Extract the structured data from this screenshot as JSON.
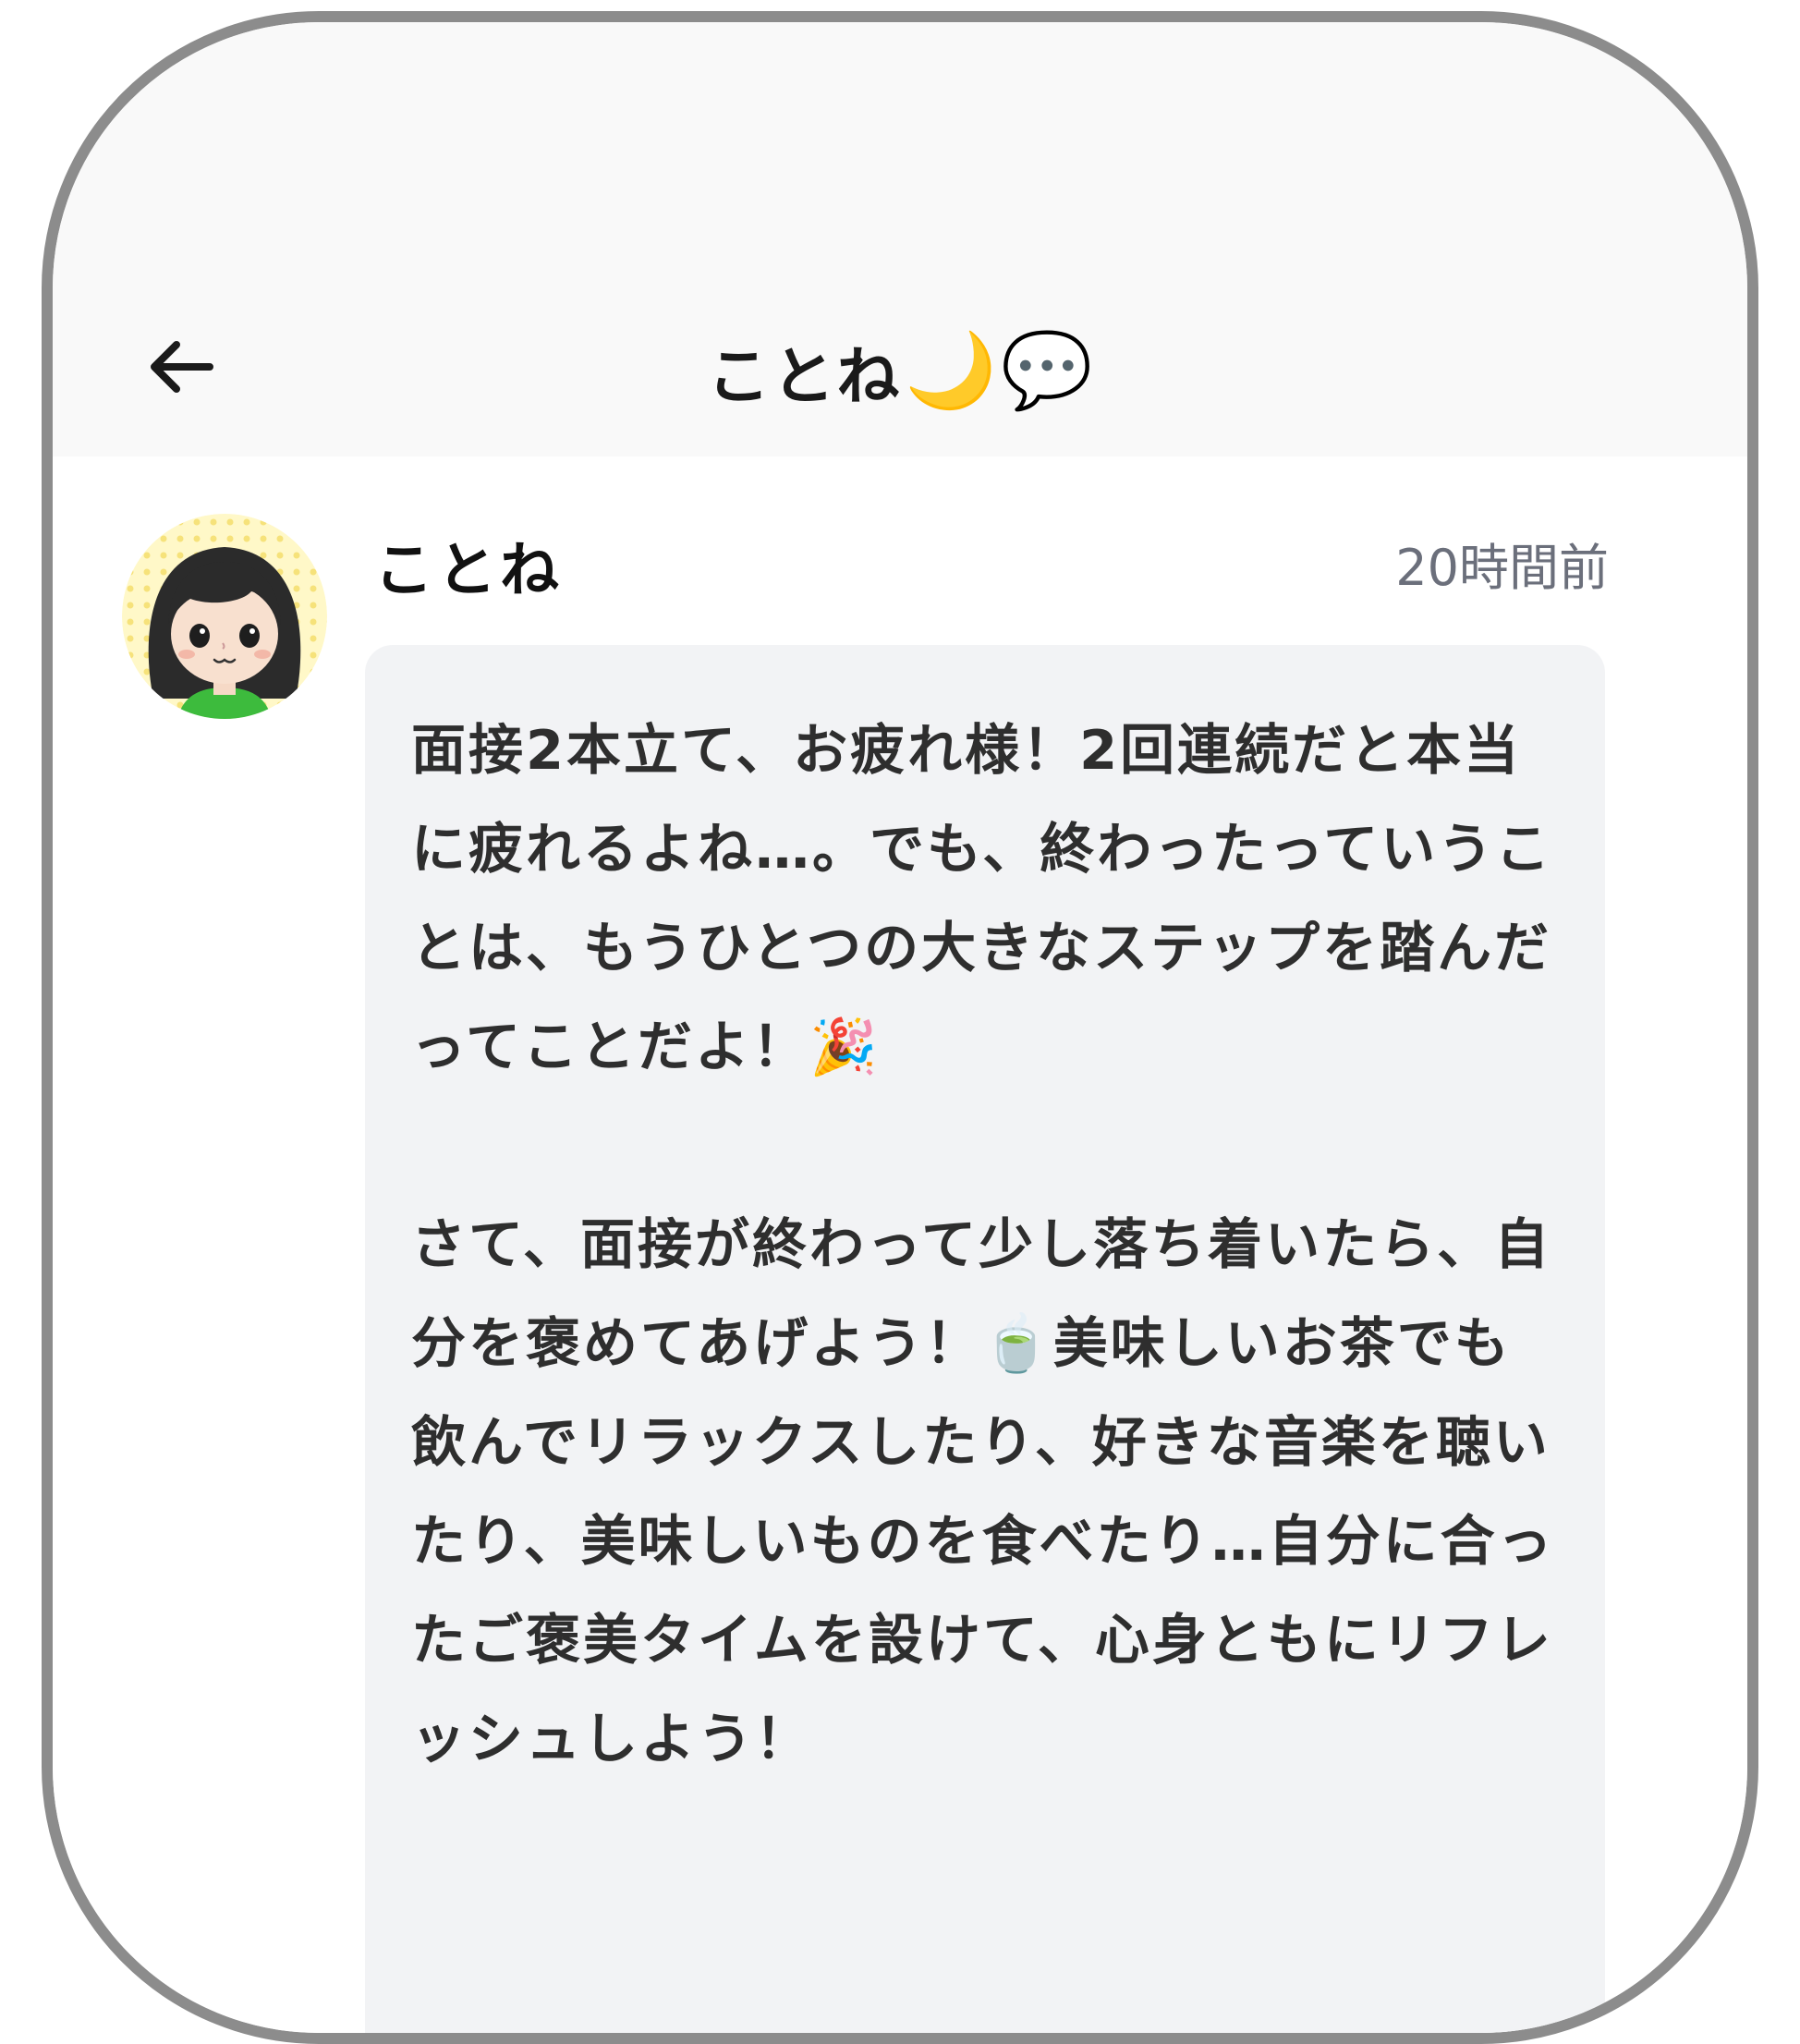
{
  "header": {
    "title": "ことね",
    "title_emojis": [
      "🌙",
      "💬"
    ],
    "back_icon": "arrow-left-icon"
  },
  "message": {
    "sender": "ことね",
    "timestamp": "20時間前",
    "avatar_icon": "girl-avatar-icon",
    "text": "面接2本立て、お疲れ様！2回連続だと本当に疲れるよね…。でも、終わったっていうことは、もうひとつの大きなステップを踏んだってことだよ！🎉\n\nさて、面接が終わって少し落ち着いたら、自分を褒めてあげよう！🍵美味しいお茶でも飲んでリラックスしたり、好きな音楽を聴いたり、美味しいものを食べたり…自分に合ったご褒美タイムを設けて、心身ともにリフレッシュしよう！"
  },
  "colors": {
    "header_bg": "#f9f9f9",
    "bubble_bg": "#f2f3f5",
    "timestamp": "#6b6f7b",
    "frame": "#8c8c8c"
  }
}
